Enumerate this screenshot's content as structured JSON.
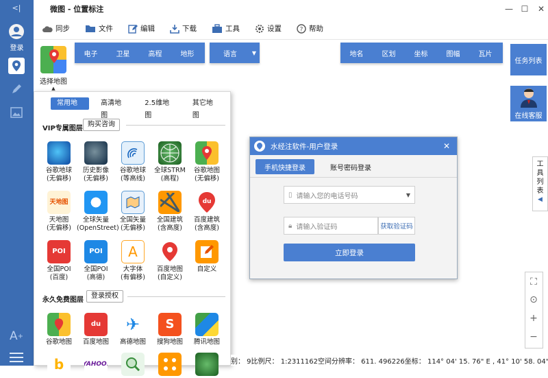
{
  "window": {
    "title": "微图 - 位置标注"
  },
  "sidebar": {
    "login_label": "登录",
    "collapse_glyph": "<|"
  },
  "toolbar": {
    "items": [
      {
        "label": "同步",
        "icon": "cloud-icon"
      },
      {
        "label": "文件",
        "icon": "folder-icon"
      },
      {
        "label": "编辑",
        "icon": "edit-icon"
      },
      {
        "label": "下载",
        "icon": "download-icon"
      },
      {
        "label": "工具",
        "icon": "toolbox-icon"
      },
      {
        "label": "设置",
        "icon": "gear-icon"
      },
      {
        "label": "帮助",
        "icon": "help-icon"
      }
    ]
  },
  "map_select": {
    "label": "选择地图"
  },
  "map_type_buttons": [
    "电子",
    "卫星",
    "高程",
    "地形"
  ],
  "language_button": "语言",
  "overlay_buttons": [
    "地名",
    "区划",
    "坐标",
    "图幅",
    "瓦片"
  ],
  "task_list": "任务列表",
  "online_service": "在线客服",
  "tools_list": "工具列表",
  "panel": {
    "tabs": [
      "常用地图",
      "高清地图",
      "2.5维地图",
      "其它地图"
    ],
    "vip_section": "VIP专属图层",
    "vip_button": "购买咨询",
    "vip_items": [
      {
        "l1": "谷歌地球",
        "l2": "(无偏移)"
      },
      {
        "l1": "历史影像",
        "l2": "(无偏移)"
      },
      {
        "l1": "谷歌地球",
        "l2": "(等高线)"
      },
      {
        "l1": "全球STRM",
        "l2": "(高程)"
      },
      {
        "l1": "谷歌地图",
        "l2": "(无偏移)"
      },
      {
        "l1": "天地图",
        "l2": "(无偏移)"
      },
      {
        "l1": "全球矢量",
        "l2": "(OpenStreet)"
      },
      {
        "l1": "全国矢量",
        "l2": "(无偏移)"
      },
      {
        "l1": "全国建筑",
        "l2": "(含高度)"
      },
      {
        "l1": "百度建筑",
        "l2": "(含高度)"
      },
      {
        "l1": "全国POI",
        "l2": "(百度)"
      },
      {
        "l1": "全国POI",
        "l2": "(高德)"
      },
      {
        "l1": "大字体",
        "l2": "(有偏移)"
      },
      {
        "l1": "百度地图",
        "l2": "(自定义)"
      },
      {
        "l1": "自定义",
        "l2": ""
      }
    ],
    "free_section": "永久免费图层",
    "free_button": "登录授权",
    "free_items": [
      "谷歌地图",
      "百度地图",
      "高德地图",
      "搜狗地图",
      "腾讯地图"
    ],
    "logo_text": {
      "tianditu": "天地图",
      "poi": "POI",
      "big_font": "A",
      "baidu": "du",
      "yahoo": "YAHOO!",
      "gaode": "✈"
    }
  },
  "dialog": {
    "title": "水经注软件-用户登录",
    "tab_active": "手机快捷登录",
    "tab_other": "账号密码登录",
    "phone_placeholder": "请输入您的电话号码",
    "code_placeholder": "请输入验证码",
    "get_code": "获取验证码",
    "login_button": "立即登录"
  },
  "status": {
    "level": "别： 9",
    "scale": "比例尺： 1:2311162",
    "resolution": "空间分辨率： 611. 496226",
    "coords": "坐标： 114° 04' 15. 76\" E , 41° 10' 58. 04\" N"
  },
  "colors": {
    "accent": "#4a7fd1",
    "sidebar": "#3c6db3"
  }
}
